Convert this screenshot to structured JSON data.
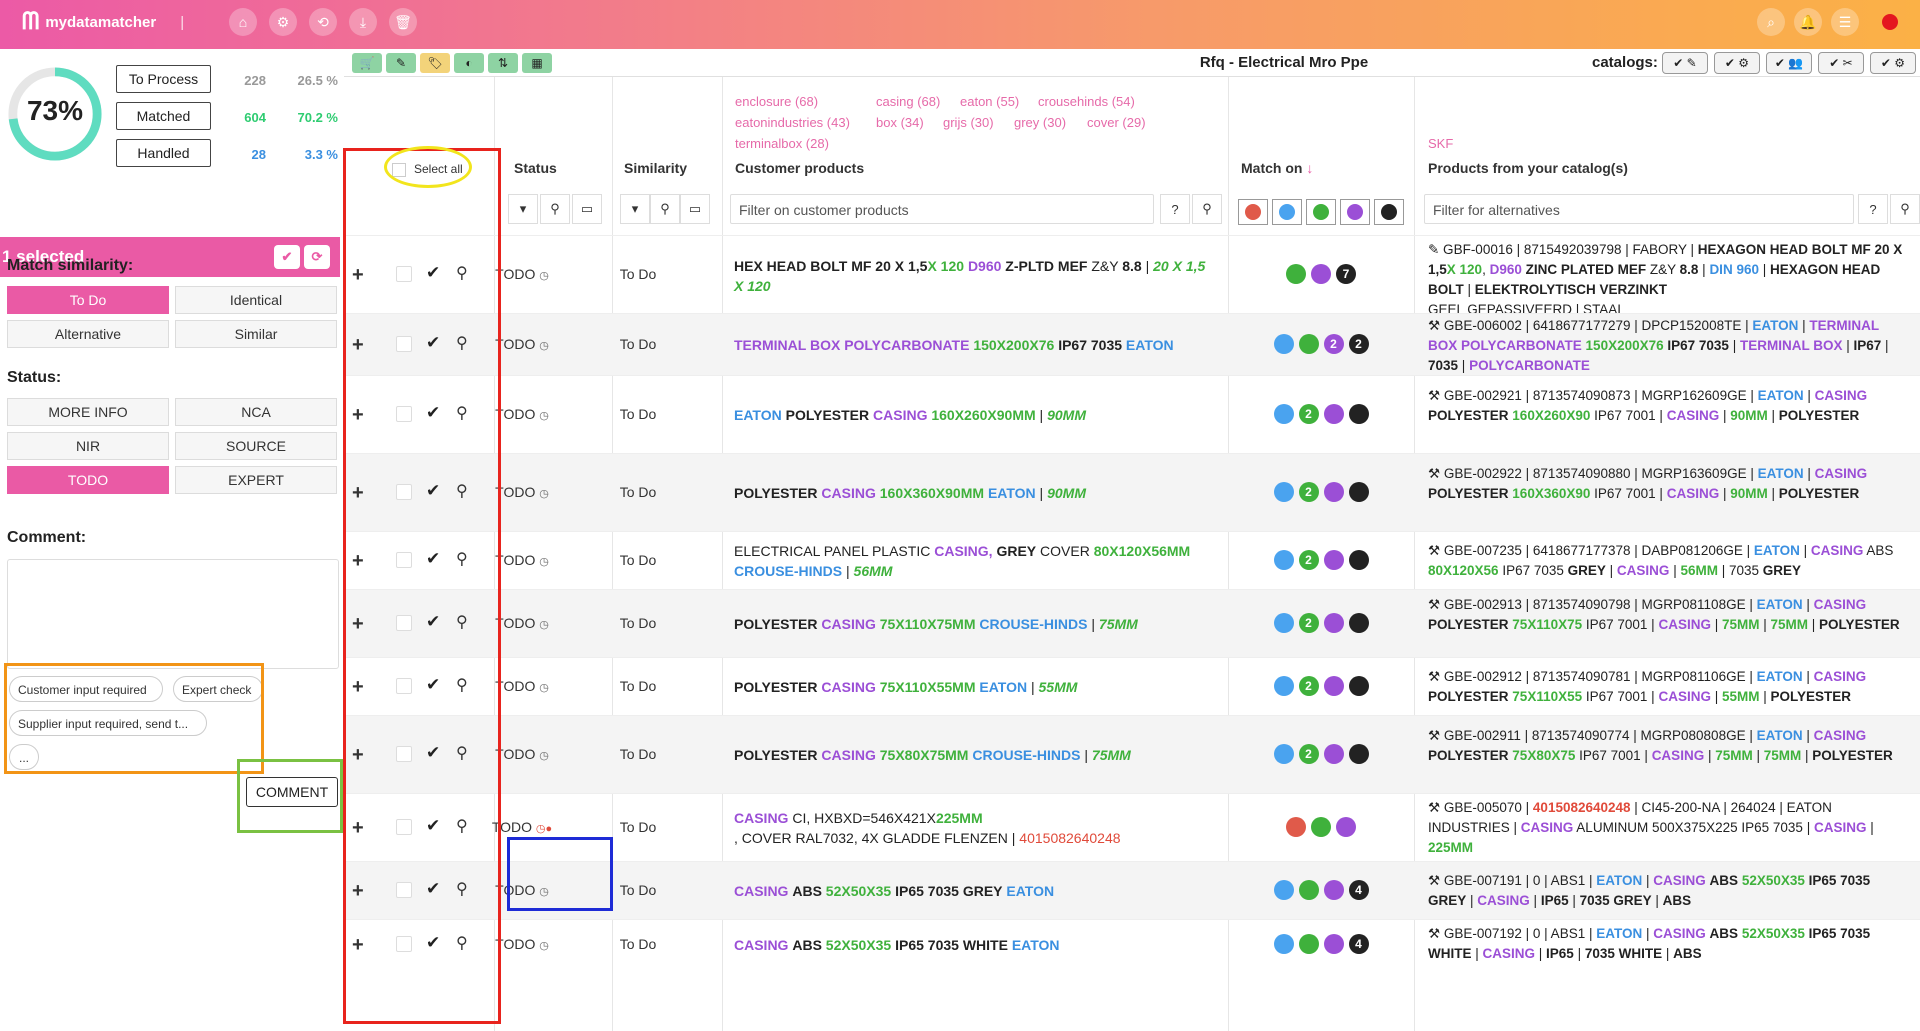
{
  "app": {
    "name": "mydatamatcher",
    "title": "Rfq - Electrical Mro Ppe",
    "catalogs_label": "catalogs:"
  },
  "topbar": {
    "nav_icons": [
      "home-icon",
      "gear-icon",
      "refresh-icon",
      "download-icon",
      "trash-icon"
    ],
    "right_icons": [
      "search-icon",
      "bell-icon",
      "menu-icon"
    ]
  },
  "stats": {
    "percent": "73%",
    "gauge_fraction": 0.73,
    "items": [
      {
        "label": "To Process",
        "count": "228",
        "pct": "26.5 %",
        "color": "#999999"
      },
      {
        "label": "Matched",
        "count": "604",
        "pct": "70.2 %",
        "color": "#2ecc71"
      },
      {
        "label": "Handled",
        "count": "28",
        "pct": "3.3 %",
        "color": "#3a8fe0"
      }
    ]
  },
  "selection": {
    "text": "1 selected"
  },
  "similarity": {
    "title": "Match similarity:",
    "options": [
      "To Do",
      "Identical",
      "Alternative",
      "Similar"
    ],
    "active": "To Do"
  },
  "status": {
    "title": "Status:",
    "options": [
      "MORE INFO",
      "NCA",
      "NIR",
      "SOURCE",
      "TODO",
      "EXPERT"
    ],
    "active": "TODO"
  },
  "comment": {
    "title": "Comment:",
    "chips": [
      "Customer input required",
      "Expert check",
      "Supplier input required, send t...",
      "..."
    ],
    "button": "COMMENT"
  },
  "columns": {
    "select_all": "Select all",
    "status": "Status",
    "similarity": "Similarity",
    "customer": "Customer products",
    "match_on": "Match on",
    "catalog": "Products from your catalog(s)"
  },
  "customer_tags": [
    "enclosure (68)",
    "casing (68)",
    "eaton (55)",
    "crousehinds (54)",
    "eatonindustries (43)",
    "box (34)",
    "grijs (30)",
    "grey (30)",
    "cover (29)",
    "terminalbox (28)"
  ],
  "catalog_tag": "SKF",
  "filters": {
    "customer_placeholder": "Filter on customer products",
    "catalog_placeholder": "Filter for alternatives"
  },
  "match_colors": [
    "#e05a4a",
    "#4aa3ef",
    "#3fb13c",
    "#9b4fd6",
    "#222222"
  ],
  "colors": {
    "accent": "#ea5aa5",
    "green": "#3fb13c",
    "purple": "#9b4fd6",
    "blue": "#3a8fe0",
    "red": "#e04a3a"
  },
  "rows": [
    {
      "status": "TODO",
      "similarity": "To Do",
      "dots": [
        "g",
        "p",
        "k7"
      ]
    },
    {
      "status": "TODO",
      "similarity": "To Do",
      "dots": [
        "b",
        "g",
        "p2",
        "k2"
      ]
    },
    {
      "status": "TODO",
      "similarity": "To Do",
      "dots": [
        "b",
        "g2",
        "p",
        "k"
      ]
    },
    {
      "status": "TODO",
      "similarity": "To Do",
      "dots": [
        "b",
        "g2",
        "p",
        "k"
      ]
    },
    {
      "status": "TODO",
      "similarity": "To Do",
      "dots": [
        "b",
        "g2",
        "p",
        "k"
      ]
    },
    {
      "status": "TODO",
      "similarity": "To Do",
      "dots": [
        "b",
        "g2",
        "p",
        "k"
      ]
    },
    {
      "status": "TODO",
      "similarity": "To Do",
      "dots": [
        "b",
        "g2",
        "p",
        "k"
      ]
    },
    {
      "status": "TODO",
      "similarity": "To Do",
      "dots": [
        "b",
        "g2",
        "p",
        "k"
      ]
    },
    {
      "status": "TODO",
      "similarity": "To Do",
      "dots": [
        "r",
        "g",
        "p"
      ]
    },
    {
      "status": "TODO",
      "similarity": "To Do",
      "dots": [
        "b",
        "g",
        "p",
        "k4"
      ]
    },
    {
      "status": "TODO",
      "similarity": "To Do",
      "dots": [
        "b",
        "g",
        "p",
        "k4"
      ]
    }
  ]
}
